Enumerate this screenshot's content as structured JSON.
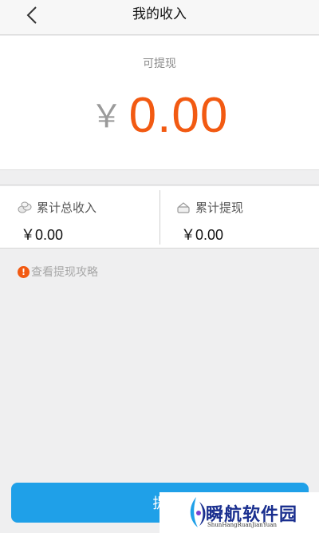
{
  "nav": {
    "title": "我的收入"
  },
  "balance": {
    "label": "可提现",
    "currency": "￥",
    "amount": "0.00"
  },
  "stats": {
    "total_income": {
      "label": "累计总收入",
      "value": "￥0.00",
      "icon": "coins-icon"
    },
    "total_withdrawn": {
      "label": "累计提现",
      "value": "￥0.00",
      "icon": "wallet-icon"
    }
  },
  "guide": {
    "label": "查看提现攻略",
    "icon": "alert-icon"
  },
  "withdraw_button": {
    "label": "提"
  },
  "watermark": {
    "title": "瞬航软件园",
    "subtitle": "ShunHangRuanJianYuan"
  },
  "colors": {
    "accent": "#f25a12",
    "button": "#1fa0e8",
    "background": "#efeff0"
  }
}
